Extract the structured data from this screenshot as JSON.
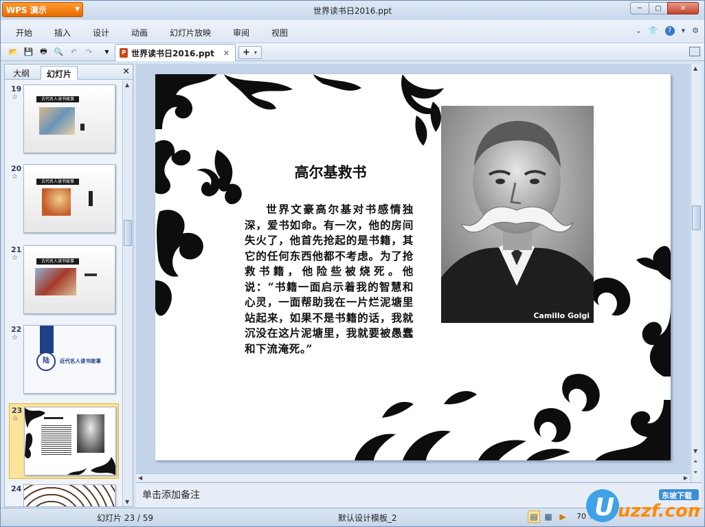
{
  "app": {
    "button_label": "WPS 演示",
    "logo_text": "WPS",
    "window_title": "世界读书日2016.ppt"
  },
  "menu": {
    "items": [
      "开始",
      "插入",
      "设计",
      "动画",
      "幻灯片放映",
      "审阅",
      "视图"
    ]
  },
  "toolbar": {
    "doc_tab": "世界读书日2016.ppt"
  },
  "left_pane": {
    "tabs": [
      "大纲",
      "幻灯片"
    ],
    "thumbnails": [
      {
        "number": "19",
        "title": "古代名人读书故事"
      },
      {
        "number": "20",
        "title": "古代名人读书故事"
      },
      {
        "number": "21",
        "title": "古代名人读书故事"
      },
      {
        "number": "22",
        "title": "近代名人读书故事",
        "badge": "陆"
      },
      {
        "number": "23",
        "title": "高尔基救书",
        "selected": true
      },
      {
        "number": "24",
        "title": ""
      }
    ]
  },
  "slide": {
    "title": "高尔基救书",
    "body": "世界文豪高尔基对书感情独深，爱书如命。有一次，他的房间失火了，他首先抢起的是书籍，其它的任何东西他都不考虑。为了抢救书籍，他险些被烧死。他说：“书籍一面启示着我的智慧和心灵，一面帮助我在一片烂泥塘里站起来，如果不是书籍的话，我就沉没在这片泥塘里，我就要被愚蠢和下流淹死。”",
    "portrait_caption": "Camillo Golgi"
  },
  "notes": {
    "placeholder": "单击添加备注"
  },
  "status": {
    "slide_count": "幻灯片 23 / 59",
    "template": "默认设计模板_2",
    "zoom": "70 %"
  },
  "watermark": {
    "text": "uzzf.com",
    "subtext": "东坡下载"
  },
  "colors": {
    "app_orange": "#e86a00",
    "selection": "#fbe39a",
    "chrome_blue": "#c9d8ea"
  }
}
